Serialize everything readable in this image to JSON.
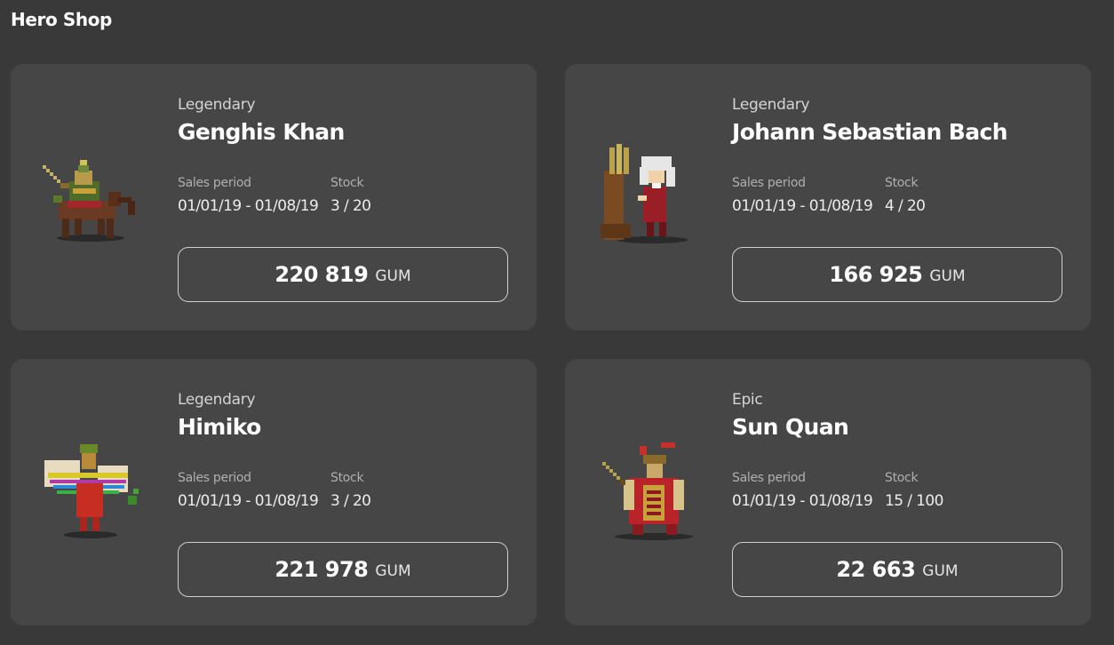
{
  "page": {
    "title": "Hero Shop"
  },
  "labels": {
    "sales_period": "Sales period",
    "stock": "Stock"
  },
  "heroes": [
    {
      "rarity": "Legendary",
      "name": "Genghis Khan",
      "sales_period": "01/01/19 - 01/08/19",
      "stock": "3 / 20",
      "price": "220 819",
      "currency": "GUM",
      "icon": "genghis-khan-sprite-icon"
    },
    {
      "rarity": "Legendary",
      "name": "Johann Sebastian Bach",
      "sales_period": "01/01/19 - 01/08/19",
      "stock": "4 / 20",
      "price": "166 925",
      "currency": "GUM",
      "icon": "bach-sprite-icon"
    },
    {
      "rarity": "Legendary",
      "name": "Himiko",
      "sales_period": "01/01/19 - 01/08/19",
      "stock": "3 / 20",
      "price": "221 978",
      "currency": "GUM",
      "icon": "himiko-sprite-icon"
    },
    {
      "rarity": "Epic",
      "name": "Sun Quan",
      "sales_period": "01/01/19 - 01/08/19",
      "stock": "15 / 100",
      "price": "22 663",
      "currency": "GUM",
      "icon": "sun-quan-sprite-icon"
    }
  ]
}
